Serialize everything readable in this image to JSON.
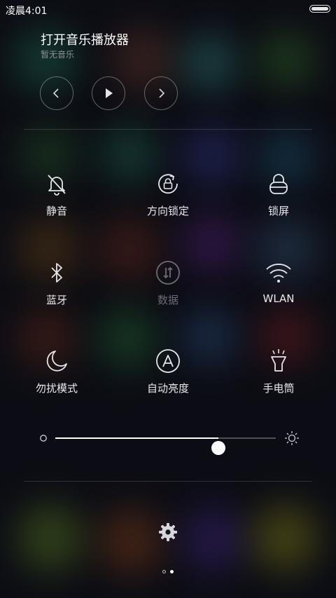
{
  "status": {
    "time": "凌晨4:01",
    "battery_level": 1.0
  },
  "player": {
    "title": "打开音乐播放器",
    "subtitle": "暂无音乐",
    "controls": [
      "chevron-left-icon",
      "play-icon",
      "chevron-right-icon"
    ]
  },
  "toggles": [
    {
      "label": "静音",
      "icon": "bell-muted-icon",
      "enabled": true
    },
    {
      "label": "方向锁定",
      "icon": "rotation-lock-icon",
      "enabled": true
    },
    {
      "label": "锁屏",
      "icon": "lock-icon",
      "enabled": true
    },
    {
      "label": "蓝牙",
      "icon": "bluetooth-icon",
      "enabled": true
    },
    {
      "label": "数据",
      "icon": "mobile-data-icon",
      "enabled": false
    },
    {
      "label": "WLAN",
      "icon": "wifi-icon",
      "enabled": true
    },
    {
      "label": "勿扰模式",
      "icon": "moon-icon",
      "enabled": true
    },
    {
      "label": "自动亮度",
      "icon": "auto-brightness-icon",
      "enabled": true
    },
    {
      "label": "手电筒",
      "icon": "flashlight-icon",
      "enabled": true
    }
  ],
  "brightness": {
    "level": 0.74
  },
  "pager": {
    "count": 2,
    "active": 1
  },
  "colors": {
    "background": "#0c0d14",
    "text": "#ffffff",
    "disabled": "#6b6d75"
  }
}
